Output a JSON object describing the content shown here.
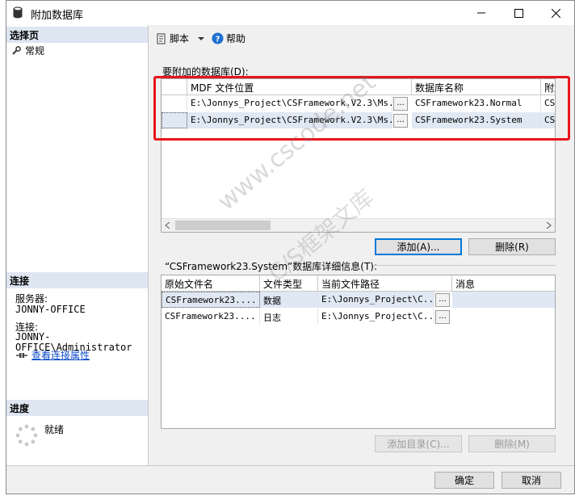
{
  "window": {
    "title": "附加数据库"
  },
  "left": {
    "select_page_header": "选择页",
    "general_item": "常规",
    "connection_header": "连接",
    "server_label": "服务器:",
    "server_value": "JONNY-OFFICE",
    "connection_label": "连接:",
    "connection_value": "JONNY-OFFICE\\Administrator",
    "view_conn_props_link": "查看连接属性",
    "progress_header": "进度",
    "progress_status": "就绪"
  },
  "toolbar": {
    "script_label": "脚本",
    "help_label": "帮助"
  },
  "attach": {
    "label": "要附加的数据库(D):",
    "columns": [
      "MDF 文件位置",
      "数据库名称",
      "附加"
    ],
    "rows": [
      {
        "mdf": "E:\\Jonnys_Project\\CSFramework.V2.3\\Ms...",
        "name": "CSFramework23.Normal",
        "attach": "CSF"
      },
      {
        "mdf": "E:\\Jonnys_Project\\CSFramework.V2.3\\Ms...",
        "name": "CSFramework23.System",
        "attach": "CSF"
      }
    ],
    "ellipsis": "...",
    "add_button": "添加(A)...",
    "remove_button": "删除(R)"
  },
  "details": {
    "label": "“CSFramework23.System”数据库详细信息(T):",
    "columns": [
      "原始文件名",
      "文件类型",
      "当前文件路径",
      "消息"
    ],
    "rows": [
      {
        "orig": "CSFramework23....",
        "type": "数据",
        "path": "E:\\Jonnys_Project\\C..."
      },
      {
        "orig": "CSFramework23....",
        "type": "日志",
        "path": "E:\\Jonnys_Project\\C..."
      }
    ],
    "add_catalog_button": "添加目录(C)...",
    "remove_button": "删除(M)"
  },
  "footer": {
    "ok_button": "确定",
    "cancel_button": "取消"
  },
  "watermark": {
    "line1": "www.cscode.net",
    "line2": "C/S框架文库"
  },
  "colors": {
    "highlight_box": "#e8141c",
    "header_bg": "#dde6f1",
    "link": "#0a4ac8"
  }
}
